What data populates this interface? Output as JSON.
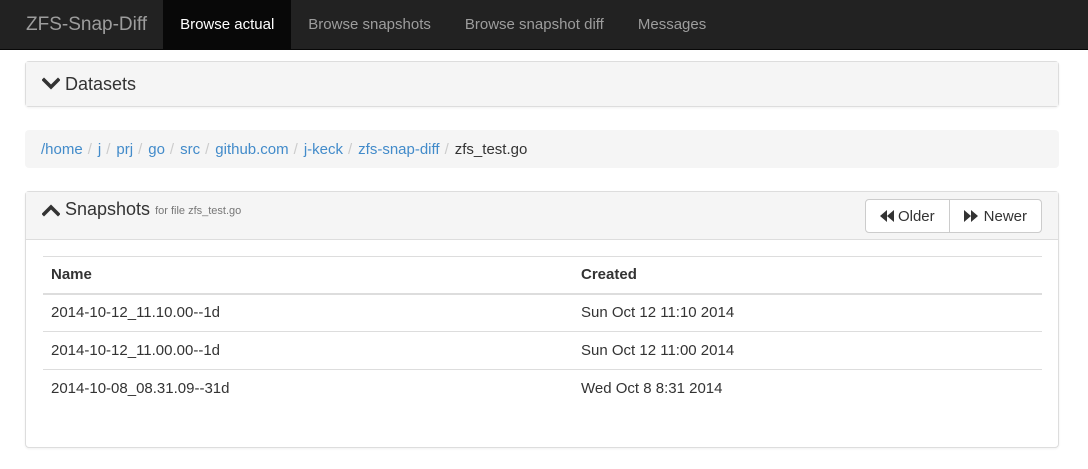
{
  "navbar": {
    "brand": "ZFS-Snap-Diff",
    "items": [
      {
        "label": "Browse actual",
        "active": true
      },
      {
        "label": "Browse snapshots",
        "active": false
      },
      {
        "label": "Browse snapshot diff",
        "active": false
      },
      {
        "label": "Messages",
        "active": false
      }
    ]
  },
  "datasets_panel": {
    "title": "Datasets",
    "icon": "chevron-down-icon"
  },
  "breadcrumb": {
    "items": [
      "/home",
      "j",
      "prj",
      "go",
      "src",
      "github.com",
      "j-keck",
      "zfs-snap-diff"
    ],
    "separator": "/",
    "current": "zfs_test.go"
  },
  "snapshots_panel": {
    "title": "Snapshots",
    "subtitle": "for file zfs_test.go",
    "icon": "chevron-up-icon",
    "older_label": "Older",
    "newer_label": "Newer",
    "columns": [
      "Name",
      "Created"
    ],
    "rows": [
      {
        "name": "2014-10-12_11.10.00--1d",
        "created": "Sun Oct 12 11:10 2014"
      },
      {
        "name": "2014-10-12_11.00.00--1d",
        "created": "Sun Oct 12 11:00 2014"
      },
      {
        "name": "2014-10-08_08.31.09--31d",
        "created": "Wed Oct 8 8:31 2014"
      }
    ]
  },
  "colors": {
    "navbar_bg": "#222222",
    "navbar_active_bg": "#080808",
    "link": "#428bca"
  }
}
